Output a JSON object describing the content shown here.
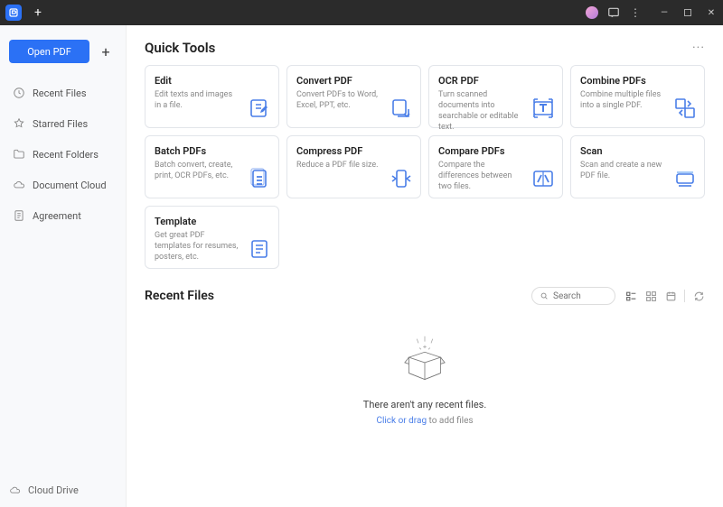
{
  "titlebar": {},
  "sidebar": {
    "open_label": "Open PDF",
    "items": [
      {
        "label": "Recent Files",
        "icon": "clock"
      },
      {
        "label": "Starred Files",
        "icon": "star"
      },
      {
        "label": "Recent Folders",
        "icon": "folder"
      },
      {
        "label": "Document Cloud",
        "icon": "cloud"
      },
      {
        "label": "Agreement",
        "icon": "doc"
      }
    ],
    "footer_label": "Cloud Drive"
  },
  "main": {
    "quick_tools_title": "Quick Tools",
    "tools": [
      {
        "title": "Edit",
        "desc": "Edit texts and images in a file.",
        "icon": "edit"
      },
      {
        "title": "Convert PDF",
        "desc": "Convert PDFs to Word, Excel, PPT, etc.",
        "icon": "convert"
      },
      {
        "title": "OCR PDF",
        "desc": "Turn scanned documents into searchable or editable text.",
        "icon": "ocr"
      },
      {
        "title": "Combine PDFs",
        "desc": "Combine multiple files into a single PDF.",
        "icon": "combine"
      },
      {
        "title": "Batch PDFs",
        "desc": "Batch convert, create, print, OCR PDFs, etc.",
        "icon": "batch"
      },
      {
        "title": "Compress PDF",
        "desc": "Reduce a PDF file size.",
        "icon": "compress"
      },
      {
        "title": "Compare PDFs",
        "desc": "Compare the differences between two files.",
        "icon": "compare"
      },
      {
        "title": "Scan",
        "desc": "Scan and create a new PDF file.",
        "icon": "scan"
      },
      {
        "title": "Template",
        "desc": "Get great PDF templates for resumes, posters, etc.",
        "icon": "template"
      }
    ],
    "recent_title": "Recent Files",
    "search_placeholder": "Search",
    "empty_text": "There aren't any recent files.",
    "empty_action_prefix": "Click or drag",
    "empty_action_suffix": " to add files"
  },
  "colors": {
    "accent": "#2b71f5"
  }
}
